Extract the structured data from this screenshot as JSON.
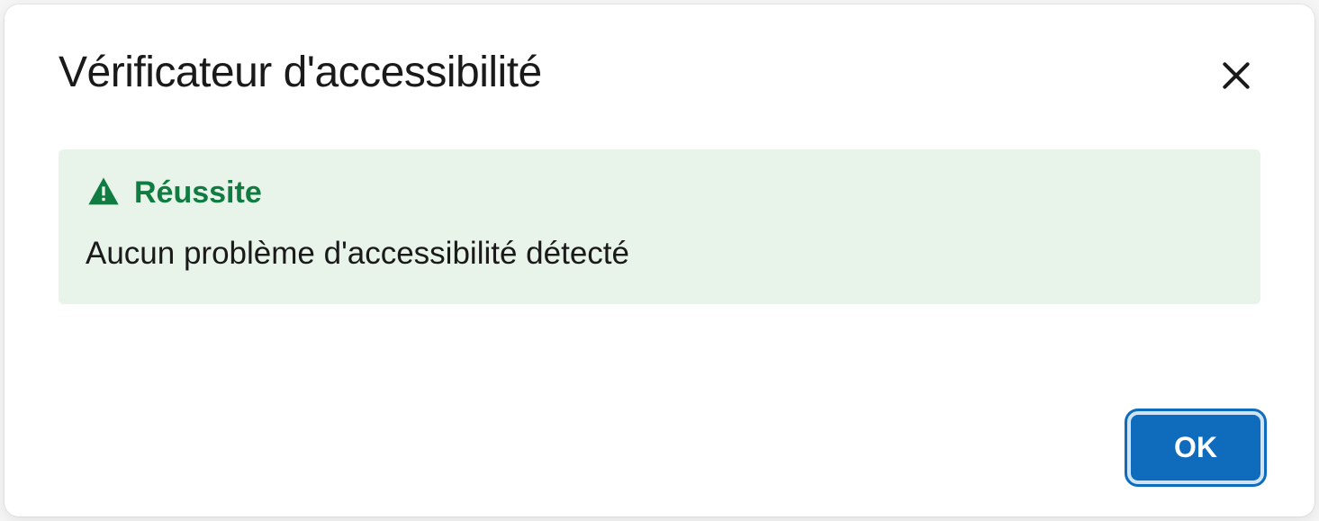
{
  "dialog": {
    "title": "Vérificateur d'accessibilité",
    "status": {
      "label": "Réussite",
      "message": "Aucun problème d'accessibilité détecté"
    },
    "buttons": {
      "ok": "OK"
    }
  }
}
